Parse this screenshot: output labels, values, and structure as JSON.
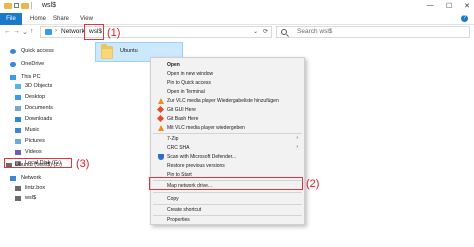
{
  "window": {
    "title": "wsl$",
    "controls": {
      "minimize": "—",
      "maximize": "☐",
      "close": "✕"
    }
  },
  "ribbon": {
    "tabs": [
      "File",
      "Home",
      "Share",
      "View"
    ],
    "help": "?"
  },
  "address": {
    "back": "←",
    "forward": "→",
    "dropdown": "⌄",
    "up": "↑",
    "crumbs": [
      "Network",
      "wsl$"
    ],
    "refresh": "⟳",
    "search_placeholder": "Search wsl$"
  },
  "annotations": {
    "a1": "(1)",
    "a2": "(2)",
    "a3": "(3)"
  },
  "sidebar": {
    "items": [
      {
        "label": "Quick access",
        "icon": "star-icon",
        "color": "#3c86d9"
      },
      {
        "label": "OneDrive",
        "icon": "cloud-icon",
        "color": "#3c86d9"
      },
      {
        "label": "This PC",
        "icon": "pc-icon",
        "color": "#3c9be6"
      },
      {
        "label": "3D Objects",
        "icon": "cube-icon",
        "color": "#5ab2e8"
      },
      {
        "label": "Desktop",
        "icon": "desktop-icon",
        "color": "#3c9be6"
      },
      {
        "label": "Documents",
        "icon": "documents-icon",
        "color": "#7aa7cf"
      },
      {
        "label": "Downloads",
        "icon": "downloads-icon",
        "color": "#2c8ad1"
      },
      {
        "label": "Music",
        "icon": "music-icon",
        "color": "#3c86d9"
      },
      {
        "label": "Pictures",
        "icon": "pictures-icon",
        "color": "#6fa8d6"
      },
      {
        "label": "Videos",
        "icon": "videos-icon",
        "color": "#6b5fb5"
      },
      {
        "label": "Local Disk (C:)",
        "icon": "drive-icon",
        "color": "#8a8a8a"
      },
      {
        "label": "Ubuntu (\\\\wsl$) (Z:)",
        "icon": "network-drive-icon",
        "color": "#6a6a6a"
      },
      {
        "label": "Network",
        "icon": "network-icon",
        "color": "#3c86d9"
      },
      {
        "label": "lintz.box",
        "icon": "computer-icon",
        "color": "#6a6a6a"
      },
      {
        "label": "wsl$",
        "icon": "computer-icon",
        "color": "#6a6a6a"
      }
    ]
  },
  "content": {
    "selected_item": "Ubuntu"
  },
  "context_menu": {
    "items": [
      {
        "label": "Open",
        "bold": true
      },
      {
        "label": "Open in new window"
      },
      {
        "label": "Pin to Quick access"
      },
      {
        "label": "Open in Terminal"
      },
      {
        "label": "Zur VLC media player Wiedergabeliste hinzufügen",
        "icon": "vlc-icon"
      },
      {
        "label": "Git GUI Here",
        "icon": "git-icon"
      },
      {
        "label": "Git Bash Here",
        "icon": "git-icon"
      },
      {
        "label": "Mit VLC media player wiedergeben",
        "icon": "vlc-icon"
      },
      {
        "label": "7-Zip",
        "submenu": true
      },
      {
        "label": "CRC SHA",
        "submenu": true
      },
      {
        "label": "Scan with Microsoft Defender...",
        "icon": "defender-icon"
      },
      {
        "label": "Restore previous versions"
      },
      {
        "label": "Pin to Start"
      },
      {
        "label": "Map network drive..."
      },
      {
        "label": "Copy"
      },
      {
        "label": "Create shortcut"
      },
      {
        "label": "Properties"
      }
    ],
    "submenu_glyph": "›"
  },
  "colors": {
    "accent": "#1979ca",
    "annotation_red": "#e2343a",
    "selection": "#cce8ff"
  }
}
